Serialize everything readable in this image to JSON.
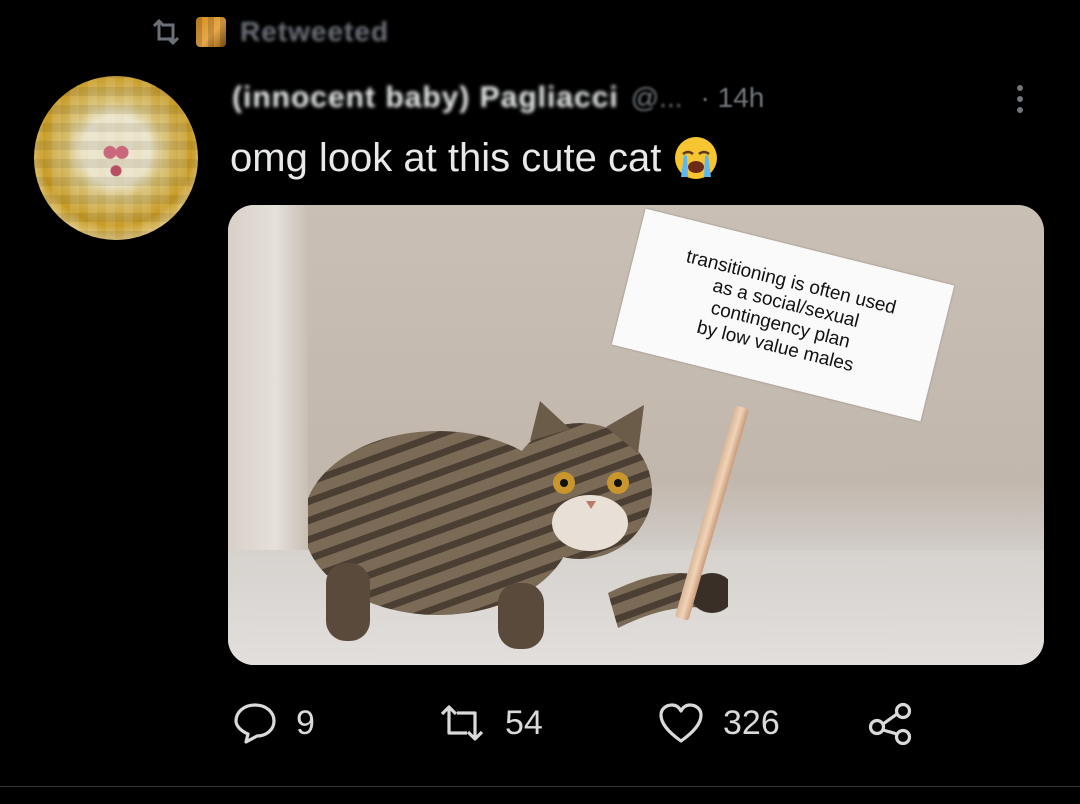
{
  "retweet_bar": {
    "text": "Retweeted"
  },
  "tweet": {
    "author_name": "(innocent baby) Pagliacci",
    "author_handle": "@...",
    "time": "· 14h",
    "text": "omg look at this cute cat",
    "emoji": "loudly-crying-face",
    "image": {
      "sign_lines": [
        "transitioning is often used",
        "as a social/sexual",
        "contingency plan",
        "by low value males"
      ]
    },
    "actions": {
      "replies": "9",
      "retweets": "54",
      "likes": "326"
    }
  },
  "colors": {
    "background": "#000000",
    "text_primary": "#e7e9ea",
    "text_secondary": "#71767b"
  }
}
